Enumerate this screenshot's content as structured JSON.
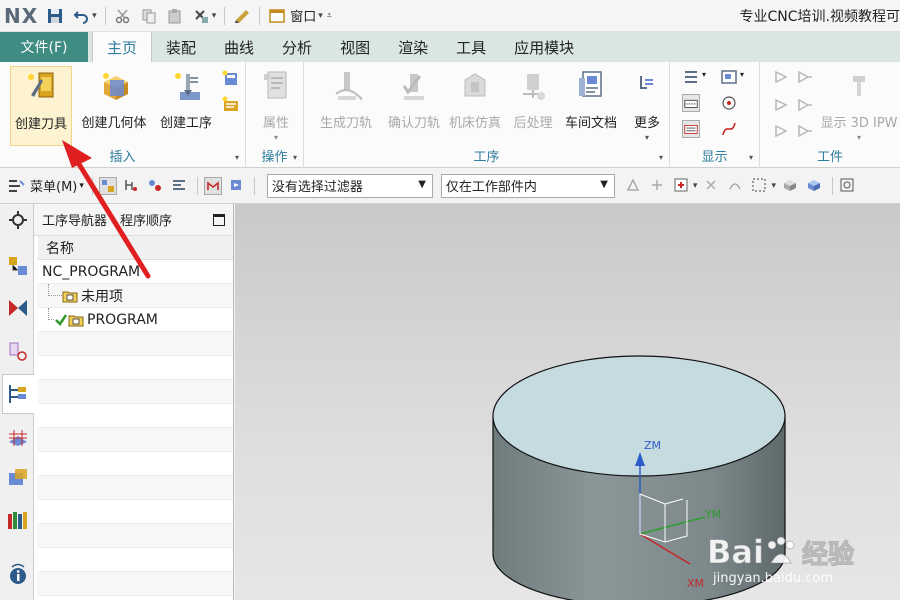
{
  "titlebar": {
    "logo": "NX",
    "window_menu": "窗口",
    "title": "专业CNC培训.视频教程可"
  },
  "tabs": {
    "file": "文件(F)",
    "items": [
      "主页",
      "装配",
      "曲线",
      "分析",
      "视图",
      "渲染",
      "工具",
      "应用模块"
    ]
  },
  "ribbon": {
    "insert": {
      "label": "插入",
      "create_tool": "创建刀具",
      "create_geometry": "创建几何体",
      "create_operation": "创建工序"
    },
    "operation": {
      "label": "操作",
      "properties": "属性"
    },
    "process": {
      "label": "工序",
      "generate_path": "生成刀轨",
      "verify_path": "确认刀轨",
      "machine_sim": "机床仿真",
      "postprocess": "后处理",
      "shop_doc": "车间文档",
      "more": "更多"
    },
    "display": {
      "label": "显示"
    },
    "workpiece": {
      "label": "工件",
      "show_3d_ipw": "显示 3D IPW"
    }
  },
  "toolbar": {
    "menu": "菜单(M)",
    "filter": "没有选择过滤器",
    "scope": "仅在工作部件内"
  },
  "navigator": {
    "title": "工序导航器 - 程序顺序",
    "column": "名称",
    "rows": [
      "NC_PROGRAM",
      "未用项",
      "PROGRAM"
    ]
  },
  "viewport": {
    "axis_z": "ZM",
    "axis_y": "YM",
    "axis_x": "XM",
    "watermark_brand": "Bai",
    "watermark_cn": "经验",
    "watermark_url": "jingyan.baidu.com"
  },
  "colors": {
    "accent": "#3f8c83",
    "tab_active_text": "#2f7d9d",
    "cylinder_top": "#c5dbe0",
    "cylinder_side": "#7c888a",
    "arrow": "#e02020"
  }
}
